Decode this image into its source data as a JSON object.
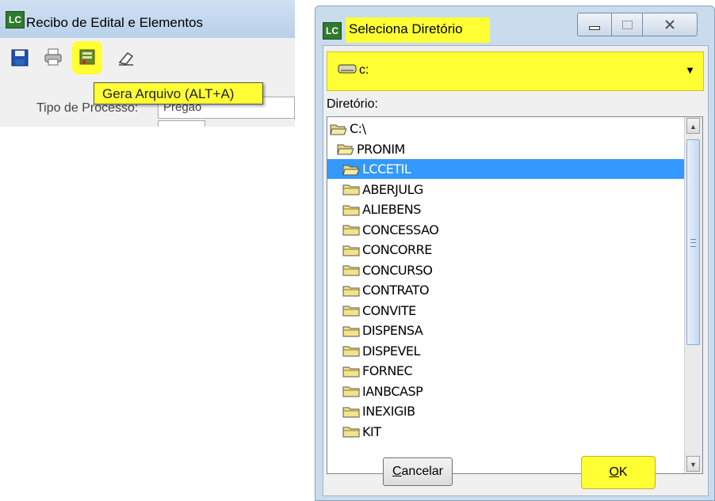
{
  "left_window": {
    "title": "Recibo de Edital e Elementos",
    "app_icon_text": "LC",
    "toolbar_icons": [
      "save-icon",
      "print-icon",
      "generate-file-icon",
      "eraser-icon"
    ],
    "tooltip": "Gera Arquivo (ALT+A)",
    "process_type_label": "Tipo de Processo:",
    "process_type_value": "Pregão"
  },
  "dialog": {
    "app_icon_text": "LC",
    "title": "Seleciona Diretório",
    "window_buttons": [
      "minimize-icon",
      "maximize-icon",
      "close-icon"
    ],
    "drive": "c:",
    "directory_label": "Diretório:",
    "directories": [
      {
        "name": "C:\\",
        "level": 0,
        "open": true,
        "selected": false
      },
      {
        "name": "PRONIM",
        "level": 1,
        "open": true,
        "selected": false
      },
      {
        "name": "LCCETIL",
        "level": 2,
        "open": true,
        "selected": true
      },
      {
        "name": "ABERJULG",
        "level": 2,
        "open": false,
        "selected": false
      },
      {
        "name": "ALIEBENS",
        "level": 2,
        "open": false,
        "selected": false
      },
      {
        "name": "CONCESSAO",
        "level": 2,
        "open": false,
        "selected": false
      },
      {
        "name": "CONCORRE",
        "level": 2,
        "open": false,
        "selected": false
      },
      {
        "name": "CONCURSO",
        "level": 2,
        "open": false,
        "selected": false
      },
      {
        "name": "CONTRATO",
        "level": 2,
        "open": false,
        "selected": false
      },
      {
        "name": "CONVITE",
        "level": 2,
        "open": false,
        "selected": false
      },
      {
        "name": "DISPENSA",
        "level": 2,
        "open": false,
        "selected": false
      },
      {
        "name": "DISPEVEL",
        "level": 2,
        "open": false,
        "selected": false
      },
      {
        "name": "FORNEC",
        "level": 2,
        "open": false,
        "selected": false
      },
      {
        "name": "IANBCASP",
        "level": 2,
        "open": false,
        "selected": false
      },
      {
        "name": "INEXIGIB",
        "level": 2,
        "open": false,
        "selected": false
      },
      {
        "name": "KIT",
        "level": 2,
        "open": false,
        "selected": false
      }
    ],
    "cancel_button": {
      "underlined": "C",
      "rest": "ancelar"
    },
    "ok_button": {
      "underlined": "O",
      "rest": "K"
    }
  },
  "colors": {
    "highlight": "#ffff33",
    "selection": "#3399ff",
    "titlebar": "#c9dced"
  }
}
